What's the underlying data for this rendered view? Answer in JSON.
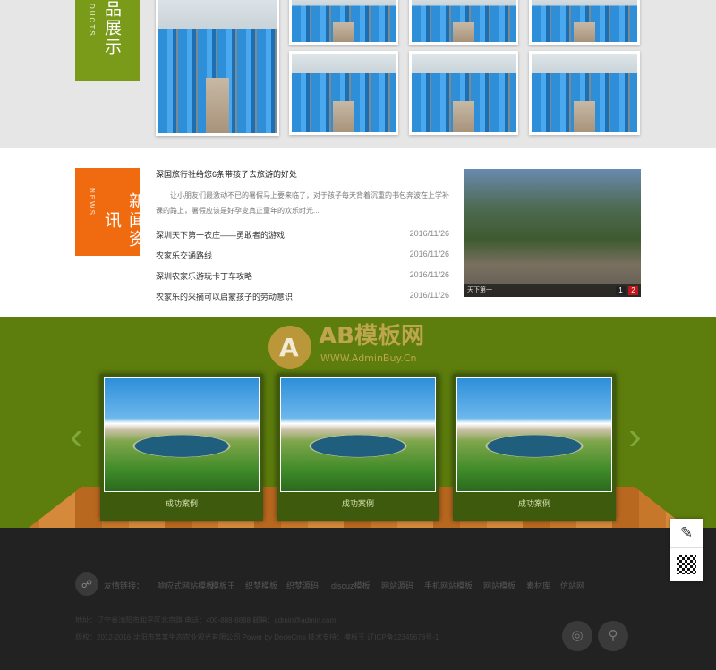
{
  "products": {
    "heading": "品展示",
    "heading_en": "DUCTS"
  },
  "news": {
    "heading": "新闻资讯",
    "heading_en": "NEWS",
    "lead": {
      "title": "深国旅行社给您6条带孩子去旅游的好处",
      "summary": "让小朋友们最激动不已的暑假马上要来临了，对于孩子每天背着沉重的书包奔波在上学补课的路上，暑假应该是好孕变真正童年的欢乐时光..."
    },
    "items": [
      {
        "title": "深圳天下第一农庄——勇敢者的游戏",
        "date": "2016/11/26"
      },
      {
        "title": "农家乐交通路线",
        "date": "2016/11/26"
      },
      {
        "title": "深圳农家乐游玩卡丁车攻略",
        "date": "2016/11/26"
      },
      {
        "title": "农家乐的采摘可以启蒙孩子的劳动意识",
        "date": "2016/11/26"
      }
    ],
    "image_caption": "天下第一",
    "pager": [
      "1",
      "2"
    ]
  },
  "watermark": {
    "brand": "AB模板网",
    "url": "WWW.AdminBuy.Cn"
  },
  "cases": {
    "items": [
      {
        "caption": "成功案例"
      },
      {
        "caption": "成功案例"
      },
      {
        "caption": "成功案例"
      }
    ]
  },
  "footer": {
    "links_label": "友情链接：",
    "links": [
      "响应式网站模板",
      "模板王",
      "织梦模板",
      "织梦源码",
      "discuz模板",
      "网站源码",
      "手机网站模板",
      "网站模板",
      "素材库",
      "仿站网"
    ],
    "line1": "地址：辽宁省沈阳市和平区北京路 电话：400-888-8888 邮箱：admin@admin.com",
    "line2": "版权：2012-2016 沈阳市某某生态农业观光有限公司 Power by DedeCms 技术支持：模板王 辽ICP备12345678号-1"
  },
  "colors": {
    "green_ribbon": "#7a9a1a",
    "orange_ribbon": "#f06a0f",
    "cases_bg": "#5d7d0d",
    "footer_bg": "#222222"
  }
}
